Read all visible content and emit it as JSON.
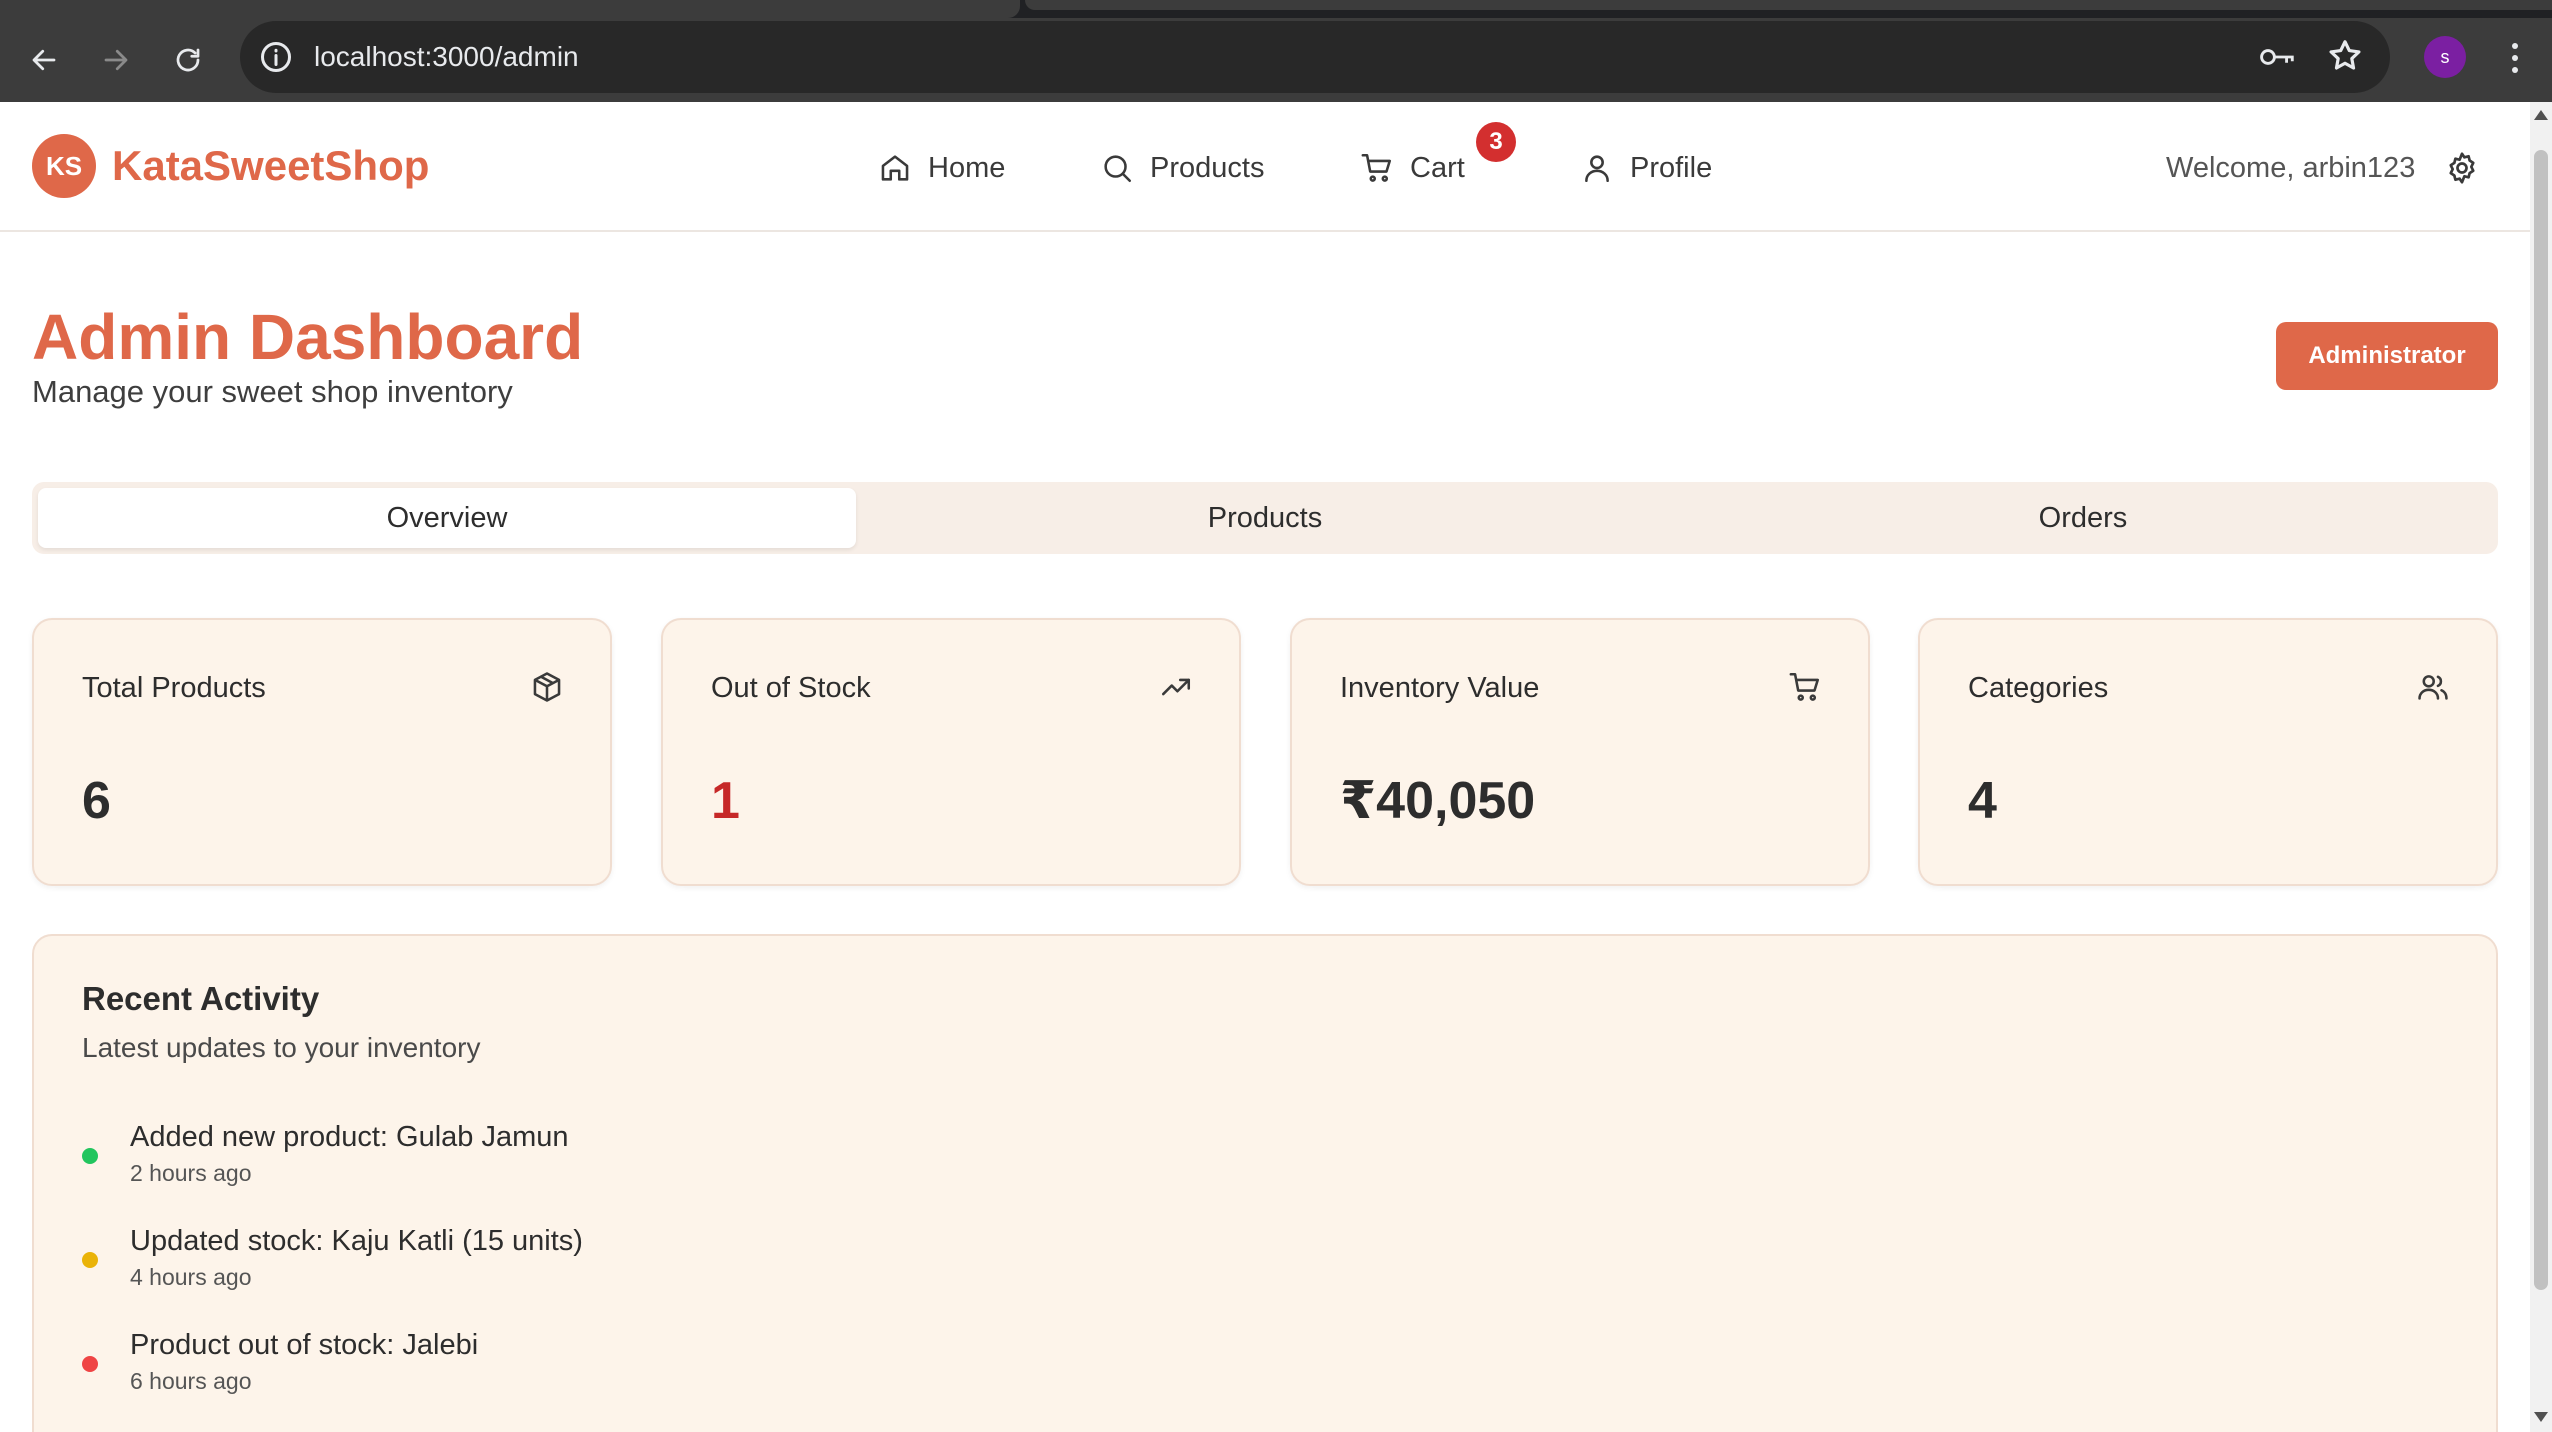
{
  "browser": {
    "url": "localhost:3000/admin",
    "profile_initial": "s"
  },
  "navbar": {
    "logo_initials": "KS",
    "brand": "KataSweetShop",
    "items": [
      {
        "label": "Home",
        "icon": "home-icon"
      },
      {
        "label": "Products",
        "icon": "search-icon"
      },
      {
        "label": "Cart",
        "icon": "cart-icon"
      },
      {
        "label": "Profile",
        "icon": "user-icon"
      }
    ],
    "cart_count": "3",
    "welcome": "Welcome, arbin123"
  },
  "header": {
    "title": "Admin Dashboard",
    "subtitle": "Manage your sweet shop inventory",
    "role_button": "Administrator"
  },
  "tabs": [
    {
      "label": "Overview",
      "active": true
    },
    {
      "label": "Products",
      "active": false
    },
    {
      "label": "Orders",
      "active": false
    }
  ],
  "stats": [
    {
      "label": "Total Products",
      "value": "6",
      "icon": "package-icon"
    },
    {
      "label": "Out of Stock",
      "value": "1",
      "icon": "trending-up-icon"
    },
    {
      "label": "Inventory Value",
      "value": "₹40,050",
      "icon": "cart-icon"
    },
    {
      "label": "Categories",
      "value": "4",
      "icon": "users-icon"
    }
  ],
  "activity": {
    "title": "Recent Activity",
    "subtitle": "Latest updates to your inventory",
    "items": [
      {
        "text": "Added new product: Gulab Jamun",
        "time": "2 hours ago",
        "color": "#22c55e"
      },
      {
        "text": "Updated stock: Kaju Katli (15 units)",
        "time": "4 hours ago",
        "color": "#eab308"
      },
      {
        "text": "Product out of stock: Jalebi",
        "time": "6 hours ago",
        "color": "#ef4444"
      }
    ]
  },
  "colors": {
    "accent": "#df6849",
    "card_bg": "#fdf4ea",
    "danger": "#c62828"
  }
}
